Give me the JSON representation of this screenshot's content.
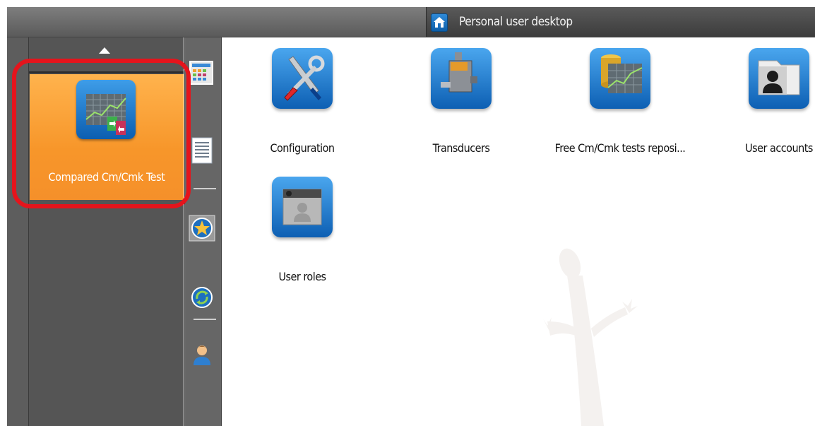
{
  "header": {
    "title": "Personal user desktop",
    "home_icon": "home-icon"
  },
  "sidebar": {
    "tile": {
      "label": "Compared Cm/Cmk Test",
      "icon": "compared-cmcmk-chart-icon",
      "selected": true
    }
  },
  "toolbar": {
    "buttons": [
      {
        "name": "grid-view-icon"
      },
      {
        "name": "list-view-icon"
      },
      {
        "name": "favorites-star-icon"
      },
      {
        "name": "recycle-icon"
      },
      {
        "name": "user-profile-icon"
      }
    ]
  },
  "desktop": {
    "apps": [
      {
        "label": "Configuration",
        "icon": "tools-icon"
      },
      {
        "label": "Transducers",
        "icon": "transducer-icon"
      },
      {
        "label": "Free Cm/Cmk tests reposi...",
        "icon": "database-chart-icon"
      },
      {
        "label": "User accounts",
        "icon": "user-accounts-icon"
      },
      {
        "label": "User roles",
        "icon": "user-roles-icon"
      }
    ]
  },
  "colors": {
    "tile_orange": "#f7962a",
    "highlight_red": "#e5141c",
    "icon_blue": "#0d5fb3"
  }
}
